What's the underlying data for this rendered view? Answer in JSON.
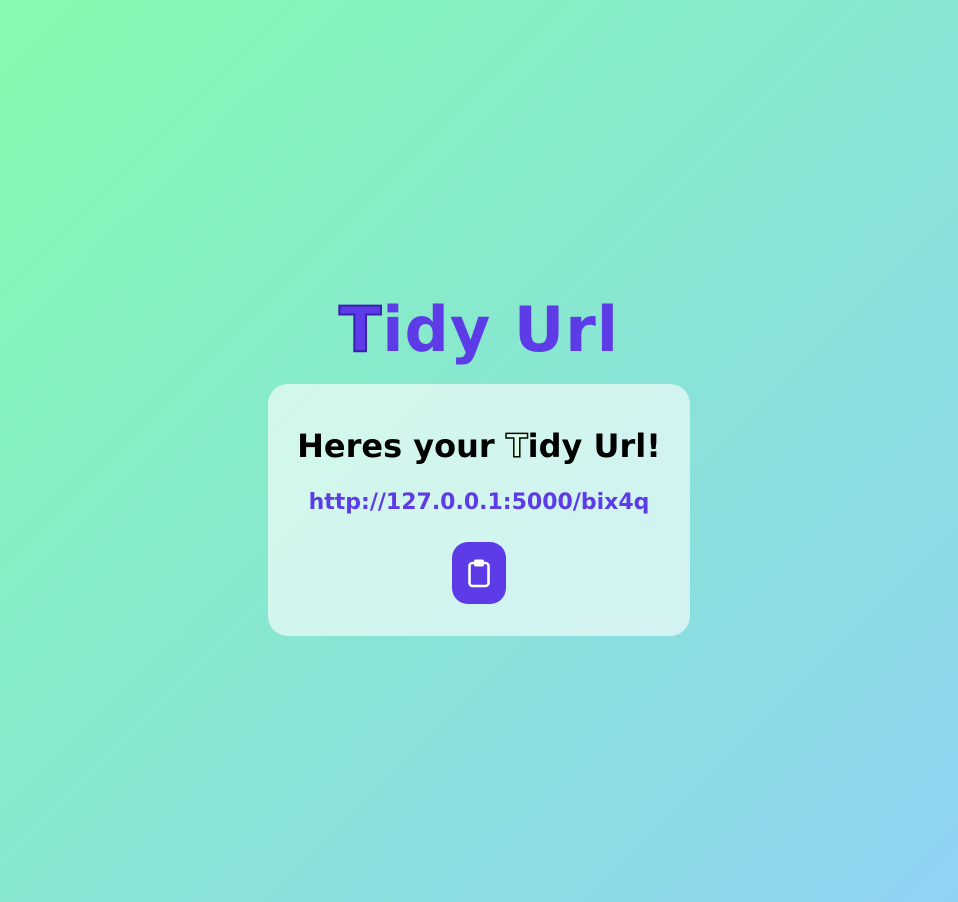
{
  "header": {
    "title_first_letter": "T",
    "title_rest": "idy Url"
  },
  "card": {
    "heading_before": "Heres your ",
    "heading_letter": "T",
    "heading_after": "idy Url!",
    "short_url": "http://127.0.0.1:5000/bix4q",
    "copy_icon": "clipboard-icon"
  },
  "colors": {
    "accent": "#5d3ce8",
    "gradient_start": "#85fbaf",
    "gradient_end": "#8fd3f4",
    "card_background": "#ffffff9e"
  }
}
